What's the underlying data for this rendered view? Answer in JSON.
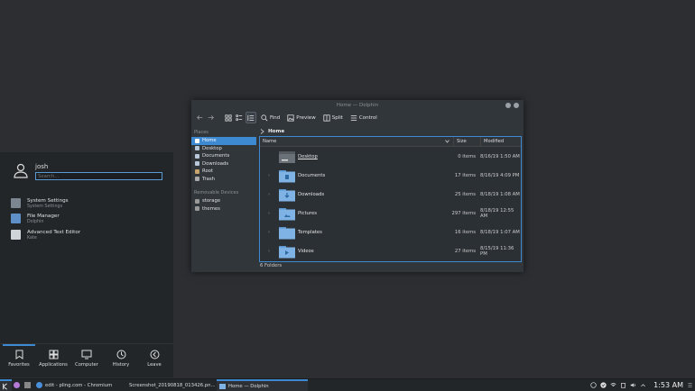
{
  "window": {
    "title": "Home — Dolphin",
    "toolbar": {
      "find": "Find",
      "preview": "Preview",
      "split": "Split",
      "control": "Control"
    },
    "places": {
      "header": "Places",
      "items": [
        "Home",
        "Desktop",
        "Documents",
        "Downloads",
        "Root",
        "Trash"
      ],
      "removable_header": "Removable Devices",
      "devices": [
        "storage",
        "themes"
      ]
    },
    "breadcrumb": "Home",
    "columns": {
      "name": "Name",
      "size": "Size",
      "modified": "Modified"
    },
    "rows": [
      {
        "name": "Desktop",
        "size": "0 items",
        "modified": "8/16/19 1:50 AM"
      },
      {
        "name": "Documents",
        "size": "17 items",
        "modified": "8/16/19 4:09 PM"
      },
      {
        "name": "Downloads",
        "size": "25 items",
        "modified": "8/18/19 1:08 AM"
      },
      {
        "name": "Pictures",
        "size": "297 items",
        "modified": "8/18/19 12:55 AM"
      },
      {
        "name": "Templates",
        "size": "16 items",
        "modified": "8/18/19 1:07 AM"
      },
      {
        "name": "Videos",
        "size": "27 items",
        "modified": "8/15/19 11:36 PM"
      }
    ],
    "status": "6 Folders"
  },
  "launcher": {
    "username": "josh",
    "search_placeholder": "Search...",
    "favorites": [
      {
        "title": "System Settings",
        "subtitle": "System Settings"
      },
      {
        "title": "File Manager",
        "subtitle": "Dolphin"
      },
      {
        "title": "Advanced Text Editor",
        "subtitle": "Kate"
      }
    ],
    "tabs": [
      "Favorites",
      "Applications",
      "Computer",
      "History",
      "Leave"
    ]
  },
  "taskbar": {
    "tasks": [
      "edit - pling.com - Chromium",
      "Screenshot_20190818_013426.pn...",
      "Home — Dolphin"
    ],
    "clock": "1:53 AM"
  },
  "colors": {
    "accent": "#3d8ad3",
    "folder": "#7fb3e6"
  }
}
